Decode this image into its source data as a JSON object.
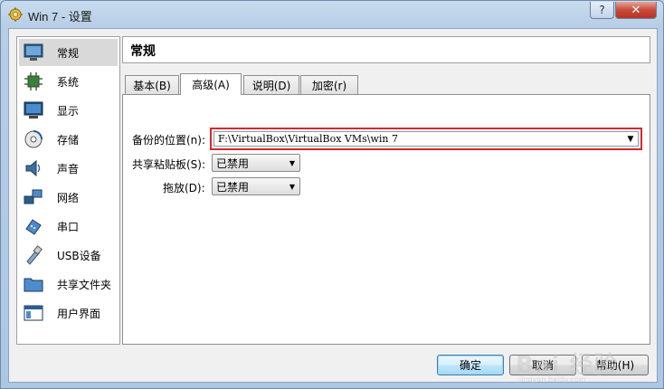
{
  "window": {
    "title": "Win 7 - 设置",
    "help_label": "?",
    "close_label": "✕"
  },
  "sidebar": {
    "items": [
      {
        "label": "常规",
        "icon": "monitor-icon"
      },
      {
        "label": "系统",
        "icon": "chip-icon"
      },
      {
        "label": "显示",
        "icon": "display-icon"
      },
      {
        "label": "存储",
        "icon": "disk-icon"
      },
      {
        "label": "声音",
        "icon": "speaker-icon"
      },
      {
        "label": "网络",
        "icon": "network-icon"
      },
      {
        "label": "串口",
        "icon": "serial-port-icon"
      },
      {
        "label": "USB设备",
        "icon": "usb-icon"
      },
      {
        "label": "共享文件夹",
        "icon": "folder-icon"
      },
      {
        "label": "用户界面",
        "icon": "window-icon"
      }
    ],
    "selected_index": 0
  },
  "header": {
    "title": "常规"
  },
  "tabs": [
    {
      "label": "基本(B)"
    },
    {
      "label": "高级(A)"
    },
    {
      "label": "说明(D)"
    },
    {
      "label": "加密(r)"
    }
  ],
  "active_tab": 1,
  "form": {
    "snapshot_label": "备份的位置(n):",
    "snapshot_value": "F:\\VirtualBox\\VirtualBox VMs\\win 7",
    "clipboard_label": "共享粘贴板(S):",
    "clipboard_value": "已禁用",
    "dragdrop_label": "拖放(D):",
    "dragdrop_value": "已禁用"
  },
  "buttons": {
    "ok": "确定",
    "cancel": "取消",
    "help": "帮助(H)"
  },
  "watermark": {
    "text": "Bai 经验",
    "sub": "jingyan.baidu.com"
  },
  "colors": {
    "highlight_border": "#d9272b",
    "selected_item": "#d9d9d9"
  }
}
